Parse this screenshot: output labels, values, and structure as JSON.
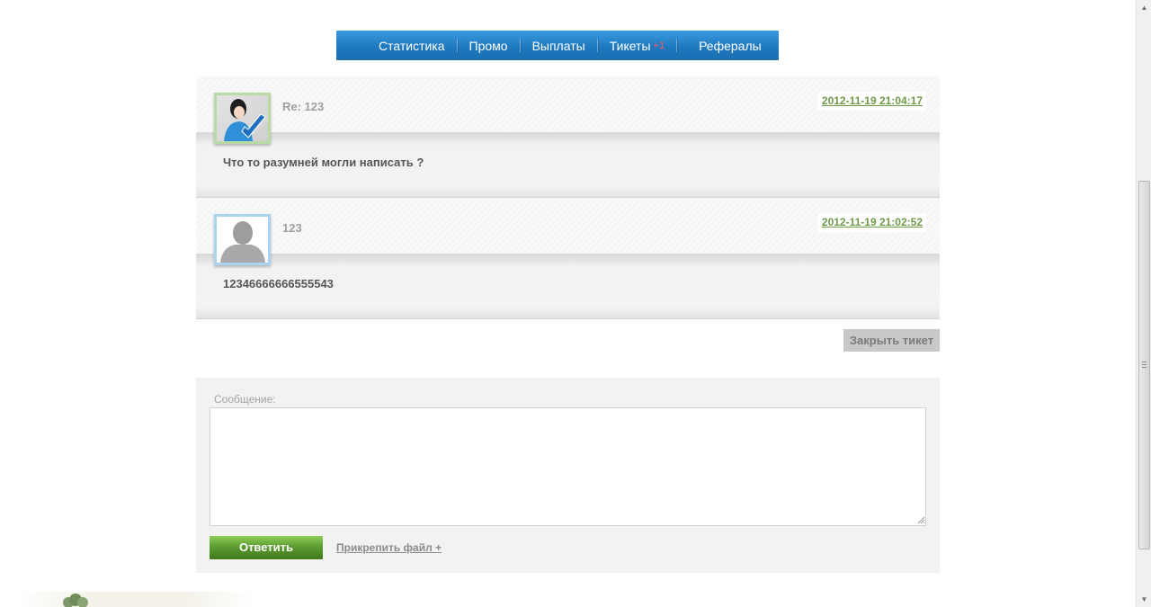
{
  "nav": {
    "items": [
      {
        "label": "Статистика"
      },
      {
        "label": "Промо"
      },
      {
        "label": "Выплаты"
      },
      {
        "label": "Тикеты",
        "badge": "+1"
      },
      {
        "label": "Рефералы"
      }
    ]
  },
  "messages": [
    {
      "title": "Re: 123",
      "date": "2012-11-19 21:04:17",
      "text": "Что то разумней могли написать ?"
    },
    {
      "title": "123",
      "date": "2012-11-19 21:02:52",
      "text": "12346666666555543"
    }
  ],
  "actions": {
    "close_ticket": "Закрыть тикет"
  },
  "reply": {
    "label": "Сообщение:",
    "value": "",
    "send_label": "Ответить",
    "attach_label": "Прикрепить файл +"
  },
  "colors": {
    "nav": "#1f79bf",
    "date": "#6f9a4a",
    "send": "#5e9b31"
  },
  "icons": {
    "avatar_support": "support-avatar-icon",
    "avatar_user": "user-silhouette-icon"
  }
}
